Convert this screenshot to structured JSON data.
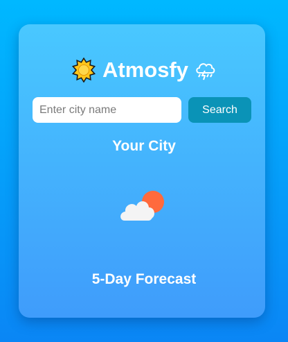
{
  "app": {
    "title": "Atmosfy"
  },
  "search": {
    "placeholder": "Enter city name",
    "value": "",
    "button_label": "Search"
  },
  "current": {
    "city": "Your City",
    "condition_icon": "partly-cloudy-icon"
  },
  "forecast": {
    "heading": "5-Day Forecast"
  },
  "colors": {
    "background_top": "#00b8ff",
    "background_bottom": "#0a86f5",
    "card_top": "#49c8ff",
    "card_bottom": "#3f9cfb",
    "search_button": "#0a93b7",
    "sun": "#ffc61a",
    "cloud": "#f4f4f4",
    "sun_behind_cloud": "#ff6a3d"
  }
}
